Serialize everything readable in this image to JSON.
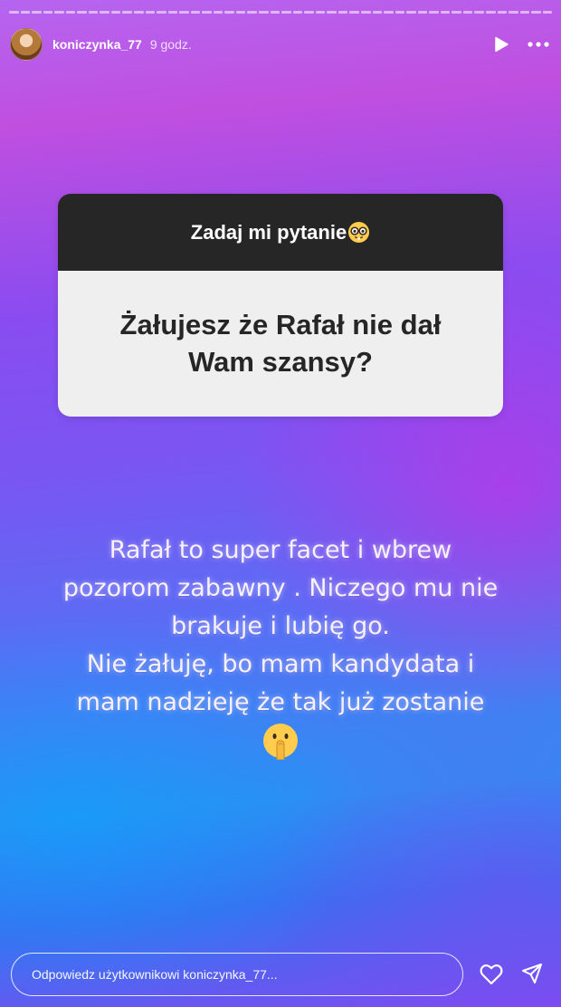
{
  "story": {
    "progress_segments": 48,
    "username": "koniczynka_77",
    "time_ago": "9 godz."
  },
  "question_sticker": {
    "prompt": "Zadaj mi pytanie",
    "prompt_emoji": "nerd-face-icon",
    "question": "Żałujesz że Rafał nie dał Wam szansy?"
  },
  "answer": {
    "text": "Rafał to super facet i wbrew\npozorom zabawny . Niczego mu nie\nbrakuje i lubię go.\nNie żałuję,  bo mam kandydata i\nmam nadzieję że tak już zostanie",
    "emoji": "shushing-face-icon"
  },
  "reply": {
    "placeholder": "Odpowiedz użytkownikowi koniczynka_77..."
  },
  "icons": {
    "play": "play-icon",
    "more": "more-icon",
    "heart": "heart-icon",
    "send": "send-icon"
  },
  "colors": {
    "card_header_bg": "#262626",
    "card_body_bg": "#efefef",
    "text_white": "#ffffff"
  }
}
